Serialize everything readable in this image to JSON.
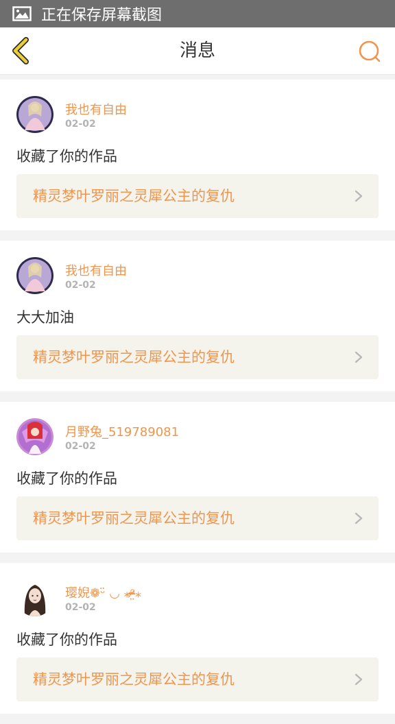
{
  "status_bar": {
    "text": "正在保存屏幕截图",
    "icon": "image-icon"
  },
  "header": {
    "title": "消息",
    "back_icon": "chevron-left-icon",
    "search_icon": "search-icon",
    "accent": "#f0954d",
    "back_color": "#e9cf3a"
  },
  "messages": [
    {
      "username": "我也有自由",
      "date": "02-02",
      "text": "收藏了你的作品",
      "work_title": "精灵梦叶罗丽之灵犀公主的复仇"
    },
    {
      "username": "我也有自由",
      "date": "02-02",
      "text": "大大加油",
      "work_title": "精灵梦叶罗丽之灵犀公主的复仇"
    },
    {
      "username": "月野兔_519789081",
      "date": "02-02",
      "text": "收藏了你的作品",
      "work_title": "精灵梦叶罗丽之灵犀公主的复仇"
    },
    {
      "username": "璎婗❁ᵕ̈ ◡ ⁎ᵒ̴̶̷̤⁎",
      "date": "02-02",
      "text": "收藏了你的作品",
      "work_title": "精灵梦叶罗丽之灵犀公主的复仇"
    }
  ]
}
